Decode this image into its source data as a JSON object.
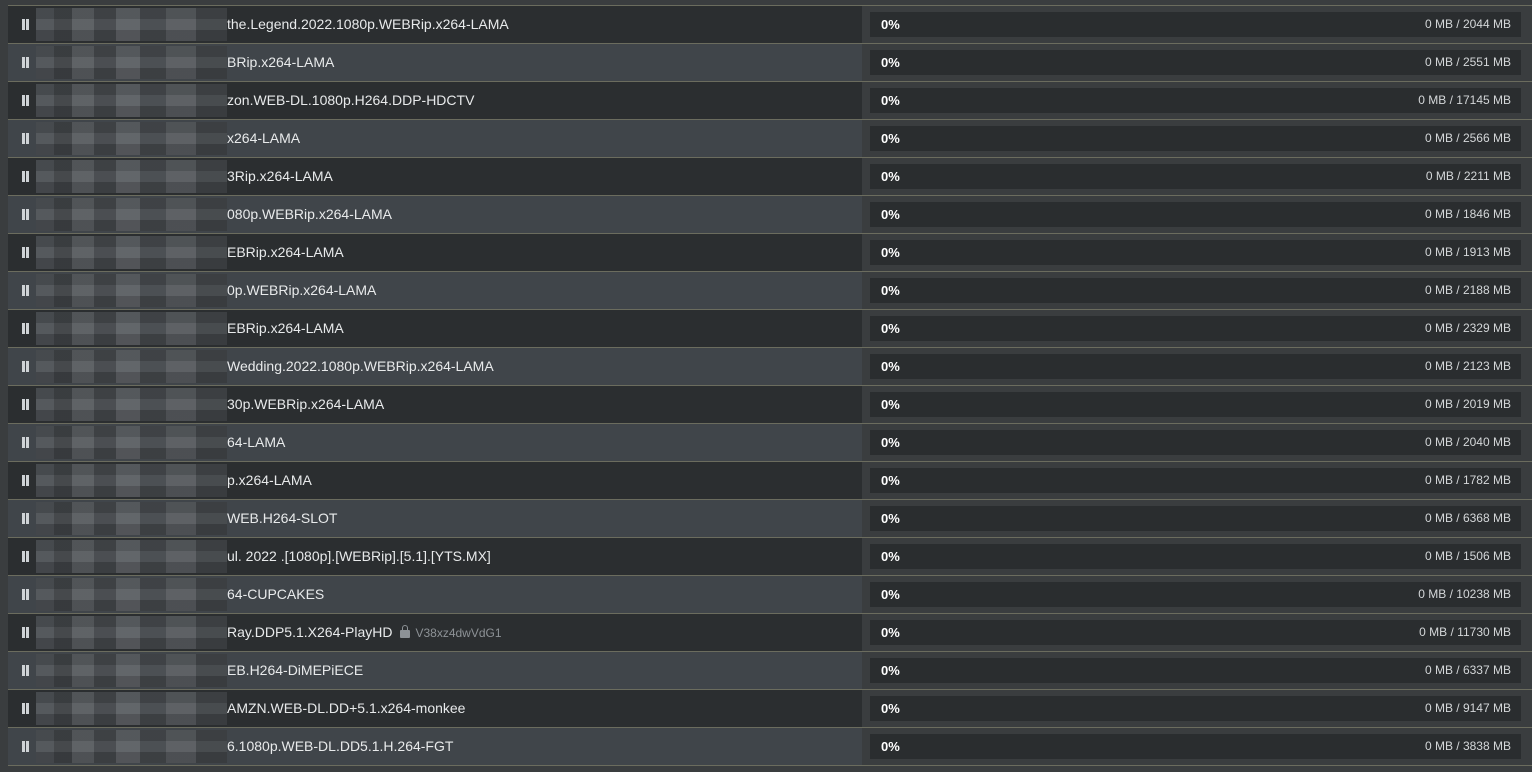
{
  "queue": [
    {
      "name": "the.Legend.2022.1080p.WEBRip.x264-LAMA",
      "percent": "0%",
      "size": "0 MB / 2044 MB"
    },
    {
      "name": "BRip.x264-LAMA",
      "percent": "0%",
      "size": "0 MB / 2551 MB"
    },
    {
      "name": "zon.WEB-DL.1080p.H264.DDP-HDCTV",
      "percent": "0%",
      "size": "0 MB / 17145 MB"
    },
    {
      "name": "x264-LAMA",
      "percent": "0%",
      "size": "0 MB / 2566 MB"
    },
    {
      "name": "3Rip.x264-LAMA",
      "percent": "0%",
      "size": "0 MB / 2211 MB"
    },
    {
      "name": "080p.WEBRip.x264-LAMA",
      "percent": "0%",
      "size": "0 MB / 1846 MB"
    },
    {
      "name": "EBRip.x264-LAMA",
      "percent": "0%",
      "size": "0 MB / 1913 MB"
    },
    {
      "name": "0p.WEBRip.x264-LAMA",
      "percent": "0%",
      "size": "0 MB / 2188 MB"
    },
    {
      "name": "EBRip.x264-LAMA",
      "percent": "0%",
      "size": "0 MB / 2329 MB"
    },
    {
      "name": "Wedding.2022.1080p.WEBRip.x264-LAMA",
      "percent": "0%",
      "size": "0 MB / 2123 MB"
    },
    {
      "name": "30p.WEBRip.x264-LAMA",
      "percent": "0%",
      "size": "0 MB / 2019 MB"
    },
    {
      "name": "64-LAMA",
      "percent": "0%",
      "size": "0 MB / 2040 MB"
    },
    {
      "name": "p.x264-LAMA",
      "percent": "0%",
      "size": "0 MB / 1782 MB"
    },
    {
      "name": "WEB.H264-SLOT",
      "percent": "0%",
      "size": "0 MB / 6368 MB"
    },
    {
      "name": "ul. 2022 .[1080p].[WEBRip].[5.1].[YTS.MX]",
      "percent": "0%",
      "size": "0 MB / 1506 MB"
    },
    {
      "name": "64-CUPCAKES",
      "percent": "0%",
      "size": "0 MB / 10238 MB"
    },
    {
      "name": "Ray.DDP5.1.X264-PlayHD",
      "password": "V38xz4dwVdG1",
      "percent": "0%",
      "size": "0 MB / 11730 MB"
    },
    {
      "name": "EB.H264-DiMEPiECE",
      "percent": "0%",
      "size": "0 MB / 6337 MB"
    },
    {
      "name": "AMZN.WEB-DL.DD+5.1.x264-monkee",
      "percent": "0%",
      "size": "0 MB / 9147 MB"
    },
    {
      "name": "6.1080p.WEB-DL.DD5.1.H.264-FGT",
      "percent": "0%",
      "size": "0 MB / 3838 MB"
    }
  ],
  "icons": {
    "pause": "pause-icon",
    "lock": "lock-icon"
  },
  "colors": {
    "row_dark": "#2b2e30",
    "row_light": "#40454a",
    "progress_bg": "#2a2d2f",
    "separator": "#6b6c5e"
  }
}
